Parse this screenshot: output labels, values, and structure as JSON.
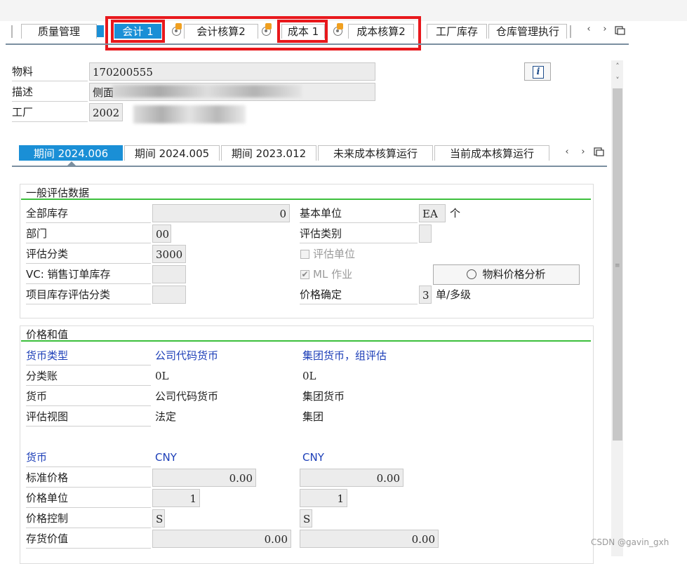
{
  "top_tabs": [
    {
      "label": "质量管理"
    },
    {
      "label": "会计 1"
    },
    {
      "label": "会计核算2"
    },
    {
      "label": "成本 1"
    },
    {
      "label": "成本核算2"
    },
    {
      "label": "工厂库存"
    },
    {
      "label": "仓库管理执行"
    }
  ],
  "header": {
    "material_label": "物料",
    "material_value": "170200555",
    "desc_label": "描述",
    "desc_value": "侧面",
    "plant_label": "工厂",
    "plant_value": "2002",
    "info_button": "i"
  },
  "period_tabs": [
    {
      "label": "期间 2024.006"
    },
    {
      "label": "期间 2024.005"
    },
    {
      "label": "期间 2023.012"
    },
    {
      "label": "未来成本核算运行"
    },
    {
      "label": "当前成本核算运行"
    }
  ],
  "general": {
    "title": "一般评估数据",
    "total_stock_label": "全部库存",
    "total_stock_value": "0",
    "base_unit_label": "基本单位",
    "base_unit_value": "EA",
    "base_unit_text": "个",
    "division_label": "部门",
    "division_value": "00",
    "valuation_category_label": "评估类别",
    "valuation_category_value": "",
    "valuation_class_label": "评估分类",
    "valuation_class_value": "3000",
    "valuated_unit_label": "评估单位",
    "vc_label": "VC: 销售订单库存",
    "vc_value": "",
    "ml_label": "ML 作业",
    "ml_checked": true,
    "price_analysis_button": "物料价格分析",
    "project_stock_label": "项目库存评估分类",
    "project_stock_value": "",
    "price_determination_label": "价格确定",
    "price_determination_value": "3",
    "price_determination_text": "单/多级"
  },
  "prices": {
    "title": "价格和值",
    "currency_type_label": "货币类型",
    "col1_header": "公司代码货币",
    "col2_header": "集团货币，组评估",
    "ledger_label": "分类账",
    "ledger_col1": "0L",
    "ledger_col2": "0L",
    "currency_label": "货币",
    "currency_col1": "公司代码货币",
    "currency_col2": "集团货币",
    "view_label": "评估视图",
    "view_col1": "法定",
    "view_col2": "集团",
    "curr_label": "货币",
    "curr_col1": "CNY",
    "curr_col2": "CNY",
    "std_price_label": "标准价格",
    "std_price_col1": "0.00",
    "std_price_col2": "0.00",
    "price_unit_label": "价格单位",
    "price_unit_col1": "1",
    "price_unit_col2": "1",
    "price_control_label": "价格控制",
    "price_control_col1": "S",
    "price_control_col2": "S",
    "stock_value_label": "存货价值",
    "stock_value_col1": "0.00",
    "stock_value_col2": "0.00"
  },
  "watermark": "CSDN @gavin_gxh",
  "colors": {
    "active_tab": "#1a8fd6",
    "highlight_box": "#e8181c",
    "section_line": "#3cbf3c",
    "blue_text": "#1d3fb8"
  }
}
